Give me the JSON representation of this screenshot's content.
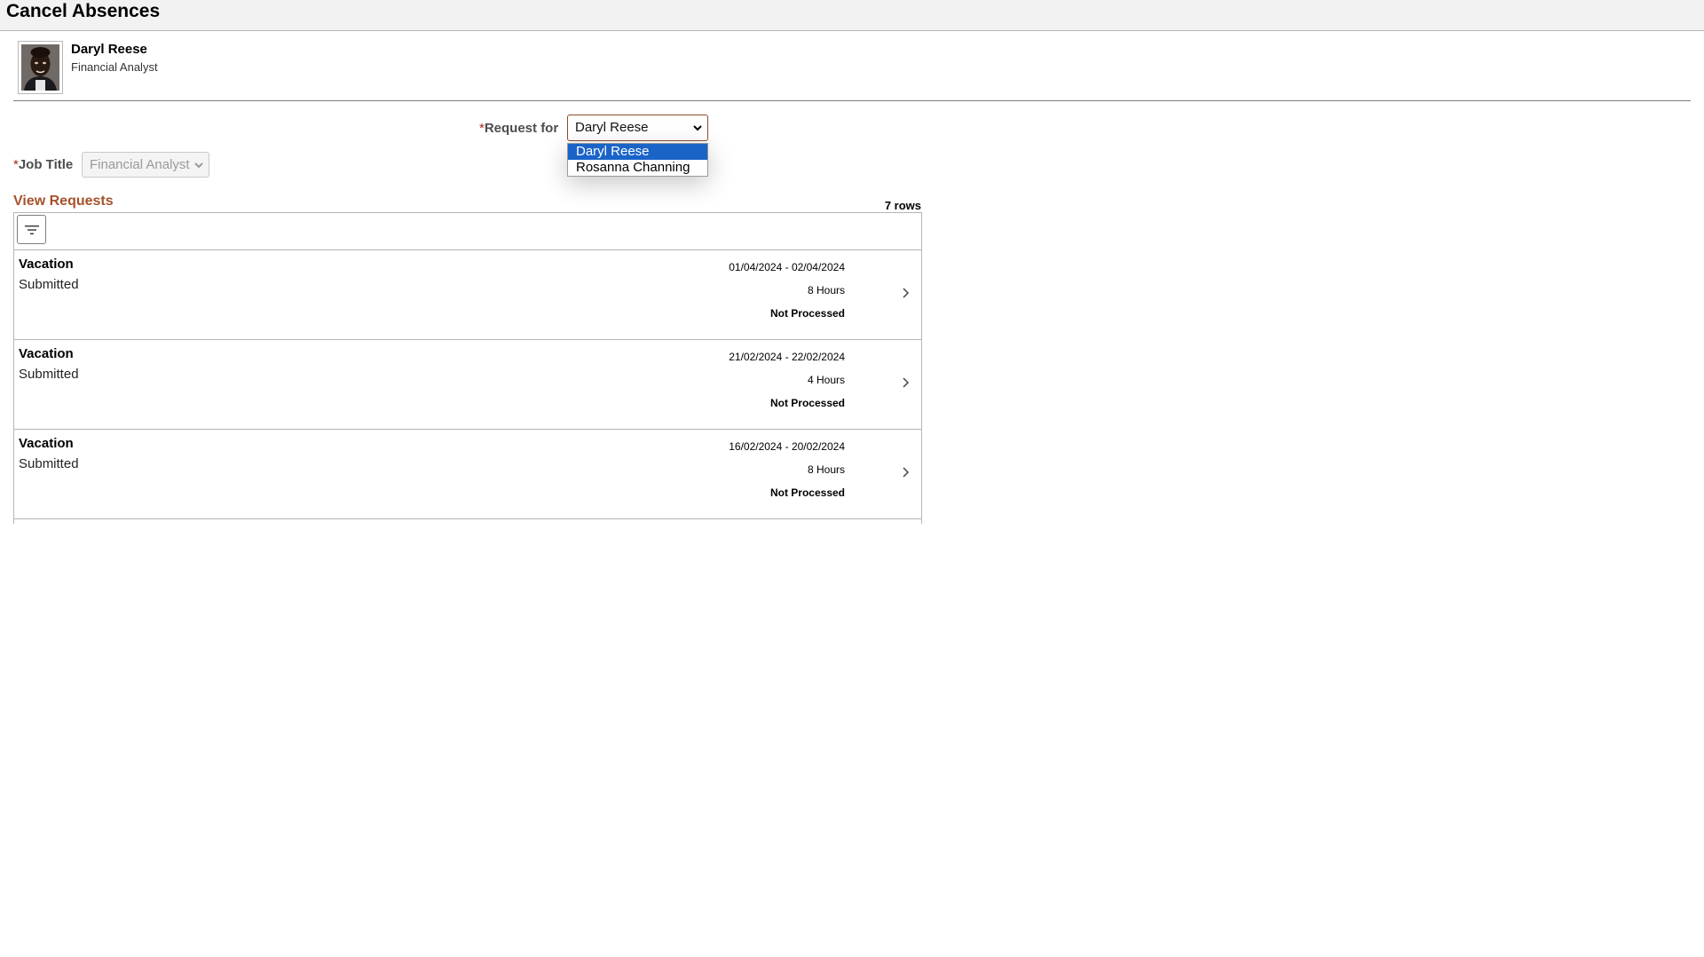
{
  "page": {
    "title": "Cancel Absences"
  },
  "employee": {
    "name": "Daryl Reese",
    "title": "Financial Analyst"
  },
  "form": {
    "request_for": {
      "required_mark": "*",
      "label": "Request for",
      "value": "Daryl Reese",
      "options": [
        "Daryl Reese",
        "Rosanna Channing"
      ]
    },
    "job_title": {
      "required_mark": "*",
      "label": "Job Title",
      "value": "Financial Analyst"
    }
  },
  "requests": {
    "title": "View Requests",
    "row_count": "7 rows",
    "rows": [
      {
        "type": "Vacation",
        "status": "Submitted",
        "dates": "01/04/2024 - 02/04/2024",
        "duration": "8 Hours",
        "processing": "Not Processed"
      },
      {
        "type": "Vacation",
        "status": "Submitted",
        "dates": "21/02/2024 - 22/02/2024",
        "duration": "4 Hours",
        "processing": "Not Processed"
      },
      {
        "type": "Vacation",
        "status": "Submitted",
        "dates": "16/02/2024 - 20/02/2024",
        "duration": "8 Hours",
        "processing": "Not Processed"
      }
    ]
  },
  "icons": {
    "filter": "filter-icon",
    "row_chevron": "chevron-right-icon",
    "select_chevron": "chevron-down-icon"
  },
  "colors": {
    "accent": "#a5532c",
    "required": "#a3261f",
    "selected_option": "#1a64c8"
  }
}
